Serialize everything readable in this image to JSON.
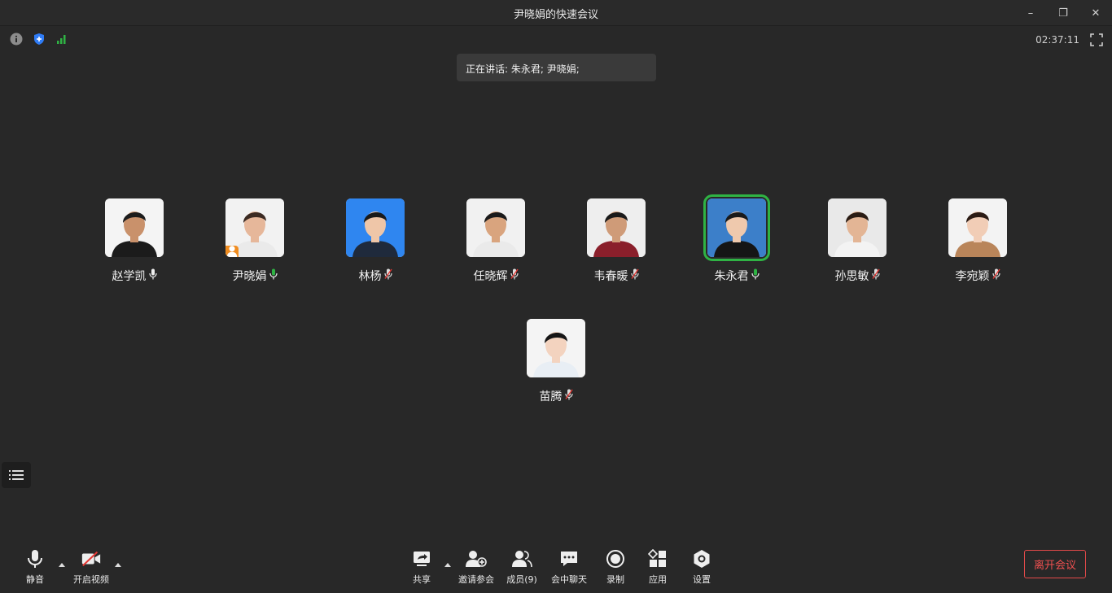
{
  "window": {
    "title": "尹晓娟的快速会议",
    "minimize": "–",
    "restore": "❐",
    "close": "✕"
  },
  "status": {
    "timer": "02:37:11",
    "icons": [
      "info-icon",
      "shield-icon",
      "signal-icon",
      "fullscreen-icon"
    ]
  },
  "speaking": {
    "text": "正在讲话: 朱永君; 尹晓娟;"
  },
  "participants": [
    {
      "name": "赵学凯",
      "mic": "white",
      "host": false,
      "active": false
    },
    {
      "name": "尹晓娟",
      "mic": "green",
      "host": true,
      "active": false
    },
    {
      "name": "林杨",
      "mic": "muted",
      "host": false,
      "active": false
    },
    {
      "name": "任晓辉",
      "mic": "muted",
      "host": false,
      "active": false
    },
    {
      "name": "韦春暖",
      "mic": "muted",
      "host": false,
      "active": false
    },
    {
      "name": "朱永君",
      "mic": "green",
      "host": false,
      "active": true
    },
    {
      "name": "孙思敏",
      "mic": "muted",
      "host": false,
      "active": false
    },
    {
      "name": "李宛颖",
      "mic": "muted",
      "host": false,
      "active": false
    },
    {
      "name": "苗腾",
      "mic": "muted",
      "host": false,
      "active": false
    }
  ],
  "toolbar": {
    "mute": "静音",
    "video": "开启视频",
    "share": "共享",
    "invite": "邀请参会",
    "members": "成员(9)",
    "chat": "会中聊天",
    "record": "录制",
    "apps": "应用",
    "settings": "设置",
    "leave": "离开会议"
  },
  "colors": {
    "background": "#282828",
    "accent_green": "#2fb344",
    "leave_red": "#e44a4a",
    "host_orange": "#f08c1f",
    "shield_blue": "#2f7cf6"
  }
}
